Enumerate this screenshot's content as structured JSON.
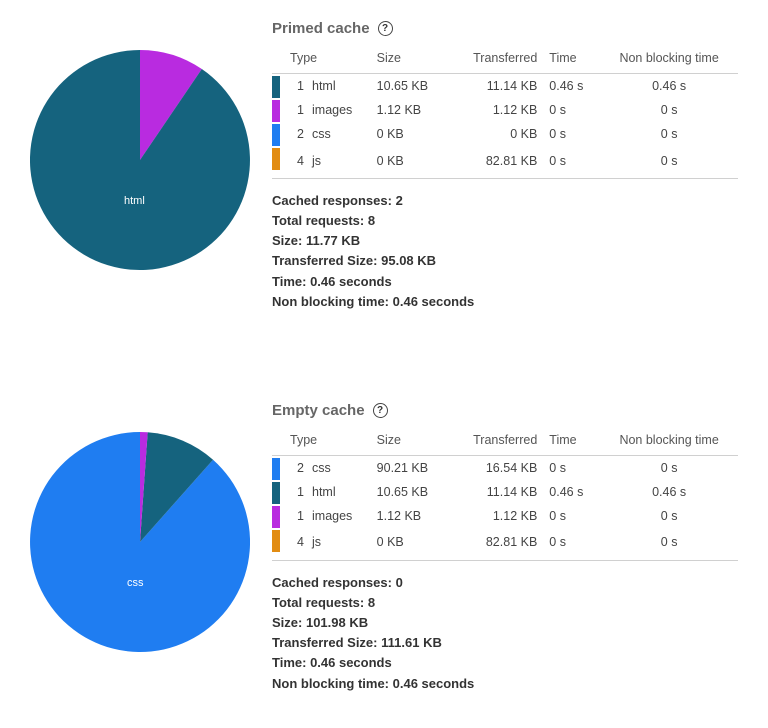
{
  "colors": {
    "html": "#15637e",
    "images": "#b92be0",
    "css": "#1f7df1",
    "js": "#e28c12"
  },
  "headers": {
    "type": "Type",
    "size": "Size",
    "transferred": "Transferred",
    "time": "Time",
    "nonblocking": "Non blocking time"
  },
  "summary_labels": {
    "cached": "Cached responses:",
    "total": "Total requests:",
    "size": "Size:",
    "transferred": "Transferred Size:",
    "time": "Time:",
    "nonblocking": "Non blocking time:"
  },
  "primed": {
    "title": "Primed cache",
    "rows": [
      {
        "color": "html",
        "count": "1",
        "type": "html",
        "size": "10.65 KB",
        "transferred": "11.14 KB",
        "time": "0.46 s",
        "nbt": "0.46 s"
      },
      {
        "color": "images",
        "count": "1",
        "type": "images",
        "size": "1.12 KB",
        "transferred": "1.12 KB",
        "time": "0 s",
        "nbt": "0 s"
      },
      {
        "color": "css",
        "count": "2",
        "type": "css",
        "size": "0 KB",
        "transferred": "0 KB",
        "time": "0 s",
        "nbt": "0 s"
      },
      {
        "color": "js",
        "count": "4",
        "type": "js",
        "size": "0 KB",
        "transferred": "82.81 KB",
        "time": "0 s",
        "nbt": "0 s"
      }
    ],
    "summary": {
      "cached": "2",
      "total": "8",
      "size": "11.77 KB",
      "transferred": "95.08 KB",
      "time": "0.46 seconds",
      "nonblocking": "0.46 seconds"
    },
    "pie_label": "html"
  },
  "empty": {
    "title": "Empty cache",
    "rows": [
      {
        "color": "css",
        "count": "2",
        "type": "css",
        "size": "90.21 KB",
        "transferred": "16.54 KB",
        "time": "0 s",
        "nbt": "0 s"
      },
      {
        "color": "html",
        "count": "1",
        "type": "html",
        "size": "10.65 KB",
        "transferred": "11.14 KB",
        "time": "0.46 s",
        "nbt": "0.46 s"
      },
      {
        "color": "images",
        "count": "1",
        "type": "images",
        "size": "1.12 KB",
        "transferred": "1.12 KB",
        "time": "0 s",
        "nbt": "0 s"
      },
      {
        "color": "js",
        "count": "4",
        "type": "js",
        "size": "0 KB",
        "transferred": "82.81 KB",
        "time": "0 s",
        "nbt": "0 s"
      }
    ],
    "summary": {
      "cached": "0",
      "total": "8",
      "size": "101.98 KB",
      "transferred": "111.61 KB",
      "time": "0.46 seconds",
      "nonblocking": "0.46 seconds"
    },
    "pie_label": "css"
  },
  "chart_data": [
    {
      "type": "pie",
      "title": "Primed cache — Size by type (KB)",
      "categories": [
        "html",
        "images",
        "css",
        "js"
      ],
      "values": [
        10.65,
        1.12,
        0,
        0
      ]
    },
    {
      "type": "pie",
      "title": "Empty cache — Size by type (KB)",
      "categories": [
        "css",
        "html",
        "images",
        "js"
      ],
      "values": [
        90.21,
        10.65,
        1.12,
        0
      ]
    }
  ]
}
